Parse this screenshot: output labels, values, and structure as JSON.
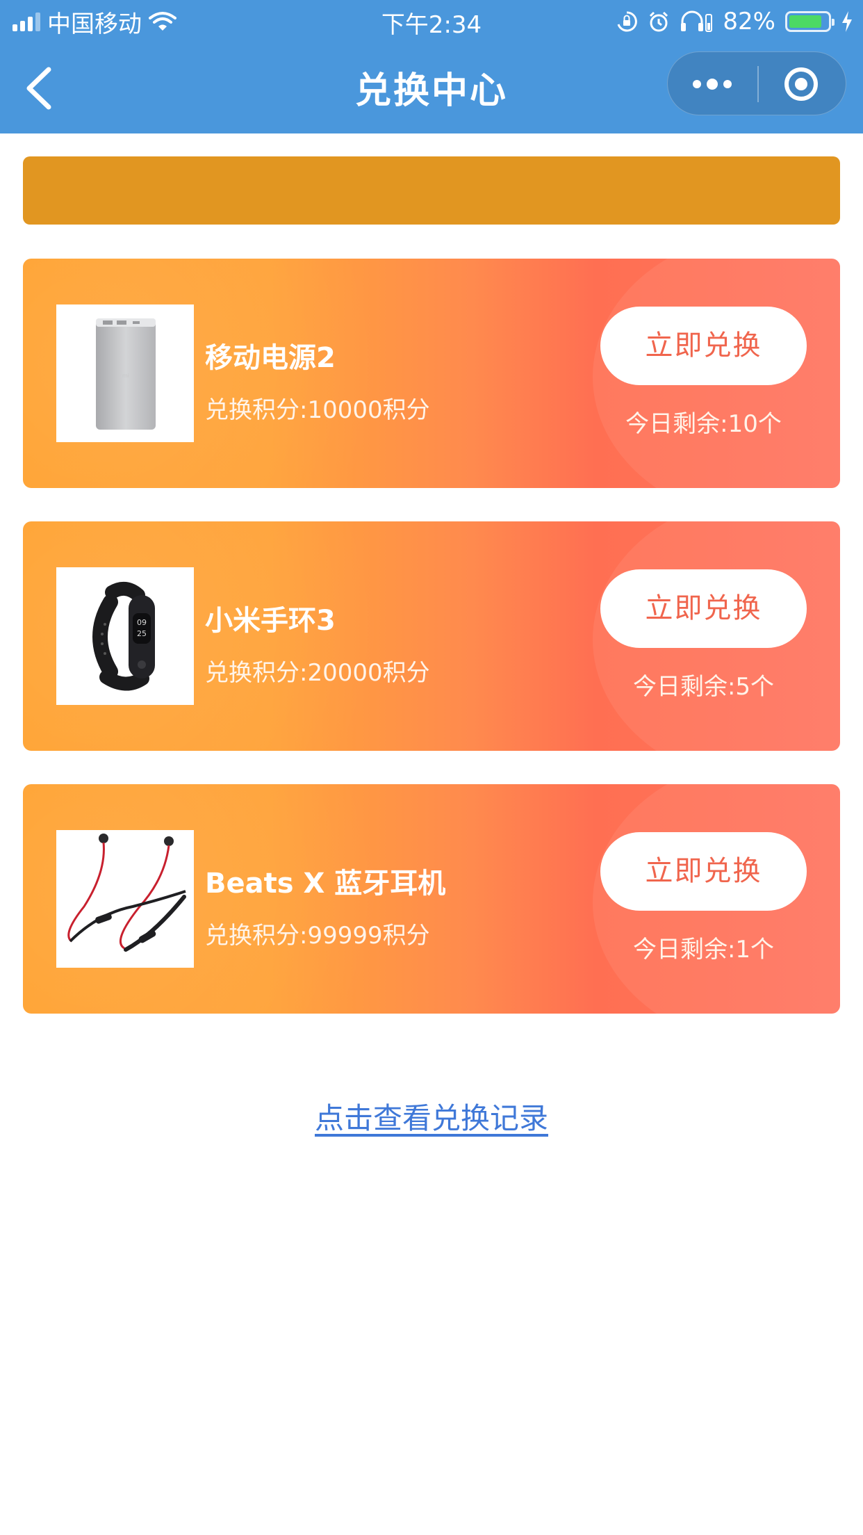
{
  "status_bar": {
    "carrier": "中国移动",
    "time": "下午2:34",
    "battery": "82%",
    "battery_level": 0.82
  },
  "nav": {
    "title": "兑换中心"
  },
  "colors": {
    "nav_bg": "#4a97dc",
    "banner": "#e19621",
    "card_start": "#ffa12e",
    "card_end": "#ff7560",
    "button_text": "#f0654d",
    "link": "#3f78d8"
  },
  "products": [
    {
      "name": "移动电源2",
      "points": "兑换积分:10000积分",
      "button": "立即兑换",
      "remaining": "今日剩余:10个",
      "image": "power-bank"
    },
    {
      "name": "小米手环3",
      "points": "兑换积分:20000积分",
      "button": "立即兑换",
      "remaining": "今日剩余:5个",
      "image": "fitness-band"
    },
    {
      "name": "Beats X 蓝牙耳机",
      "points": "兑换积分:99999积分",
      "button": "立即兑换",
      "remaining": "今日剩余:1个",
      "image": "earphones"
    }
  ],
  "footer_link": "点击查看兑换记录"
}
